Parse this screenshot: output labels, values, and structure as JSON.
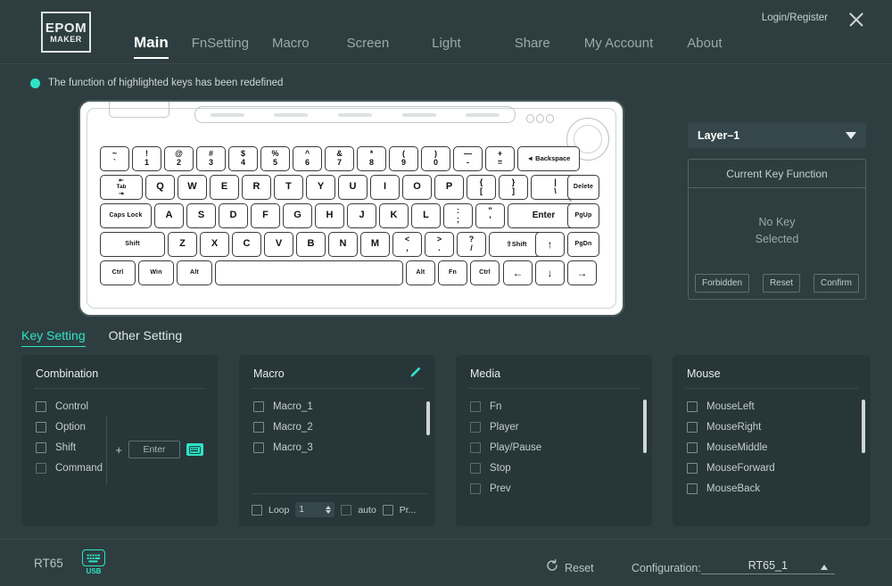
{
  "header": {
    "logo_line1": "EPOM",
    "logo_line2": "MAKER",
    "login_label": "Login/Register",
    "close_icon": "close-icon",
    "nav": [
      {
        "label": "Main",
        "active": true
      },
      {
        "label": "FnSetting",
        "active": false
      },
      {
        "label": "Macro",
        "active": false
      },
      {
        "label": "Screen",
        "active": false
      },
      {
        "label": "Light",
        "active": false
      },
      {
        "label": "Share",
        "active": false
      },
      {
        "label": "My Account",
        "active": false
      },
      {
        "label": "About",
        "active": false
      }
    ]
  },
  "notice": {
    "text": "The function of highlighted keys has been redefined",
    "dot_color": "#2fe3c8"
  },
  "keyboard": {
    "model": "RT65",
    "rows": {
      "r1": [
        {
          "top": "~",
          "bot": "`"
        },
        {
          "top": "!",
          "bot": "1"
        },
        {
          "top": "@",
          "bot": "2"
        },
        {
          "top": "#",
          "bot": "3"
        },
        {
          "top": "$",
          "bot": "4"
        },
        {
          "top": "%",
          "bot": "5"
        },
        {
          "top": "^",
          "bot": "6"
        },
        {
          "top": "&",
          "bot": "7"
        },
        {
          "top": "*",
          "bot": "8"
        },
        {
          "top": "(",
          "bot": "9"
        },
        {
          "top": ")",
          "bot": "0"
        },
        {
          "top": "—",
          "bot": "-"
        },
        {
          "top": "+",
          "bot": "="
        }
      ],
      "r1_last": "Backspace",
      "r2_first": {
        "l1": "⇤",
        "l2": "Tab",
        "l3": "⇥"
      },
      "r2": [
        "Q",
        "W",
        "E",
        "R",
        "T",
        "Y",
        "U",
        "I",
        "O",
        "P"
      ],
      "r2_brackets": [
        {
          "top": "{",
          "bot": "["
        },
        {
          "top": "}",
          "bot": "]"
        },
        {
          "top": "|",
          "bot": "\\"
        }
      ],
      "r3_first": "Caps Lock",
      "r3": [
        "A",
        "S",
        "D",
        "F",
        "G",
        "H",
        "J",
        "K",
        "L"
      ],
      "r3_punct": [
        {
          "top": ":",
          "bot": ";"
        },
        {
          "top": "\"",
          "bot": "'"
        }
      ],
      "r3_last": "Enter",
      "r4_first": "Shift",
      "r4": [
        "Z",
        "X",
        "C",
        "V",
        "B",
        "N",
        "M"
      ],
      "r4_punct": [
        {
          "top": "<",
          "bot": ","
        },
        {
          "top": ">",
          "bot": "."
        },
        {
          "top": "?",
          "bot": "/"
        }
      ],
      "r4_last": "⇧Shift",
      "r5": [
        "Ctrl",
        "Win",
        "Alt"
      ],
      "r5_right": [
        "Alt",
        "Fn",
        "Ctrl"
      ],
      "right_col": [
        "Delete",
        "PgUp",
        "PgDn"
      ],
      "arrows": {
        "up": "↑",
        "left": "←",
        "down": "↓",
        "right": "→"
      }
    }
  },
  "right_panel": {
    "layer": {
      "value": "Layer–1",
      "caret_icon": "chevron-down-icon"
    },
    "key_function": {
      "title": "Current Key Function",
      "body_line1": "No Key",
      "body_line2": "Selected",
      "buttons": [
        "Forbidden",
        "Reset",
        "Confirm"
      ]
    }
  },
  "tabs": [
    {
      "label": "Key Setting",
      "active": true
    },
    {
      "label": "Other Setting",
      "active": false
    }
  ],
  "panels": {
    "combination": {
      "title": "Combination",
      "items": [
        "Control",
        "Option",
        "Shift",
        "Command"
      ],
      "plus": "+",
      "enter_label": "Enter",
      "keyboard_icon": "keyboard-icon"
    },
    "macro": {
      "title": "Macro",
      "edit_icon": "pencil-icon",
      "items": [
        "Macro_1",
        "Macro_2",
        "Macro_3"
      ],
      "footer": {
        "loop_label": "Loop",
        "loop_value": "1",
        "auto_label": "auto",
        "pr_label": "Pr..."
      }
    },
    "media": {
      "title": "Media",
      "items": [
        "Fn",
        "Player",
        "Play/Pause",
        "Stop",
        "Prev"
      ]
    },
    "mouse": {
      "title": "Mouse",
      "items": [
        "MouseLeft",
        "MouseRight",
        "MouseMiddle",
        "MouseForward",
        "MouseBack"
      ]
    }
  },
  "footer": {
    "device_name": "RT65",
    "usb_label": "USB",
    "usb_icon": "keyboard-usb-icon",
    "reset_label": "Reset",
    "reset_icon": "refresh-icon",
    "configuration_label": "Configuration:",
    "configuration_value": "RT65_1",
    "caret_icon": "chevron-up-icon"
  },
  "colors": {
    "background": "#2e3e40",
    "panel": "#273639",
    "accent": "#2fe3c8",
    "text": "#c4cece"
  }
}
